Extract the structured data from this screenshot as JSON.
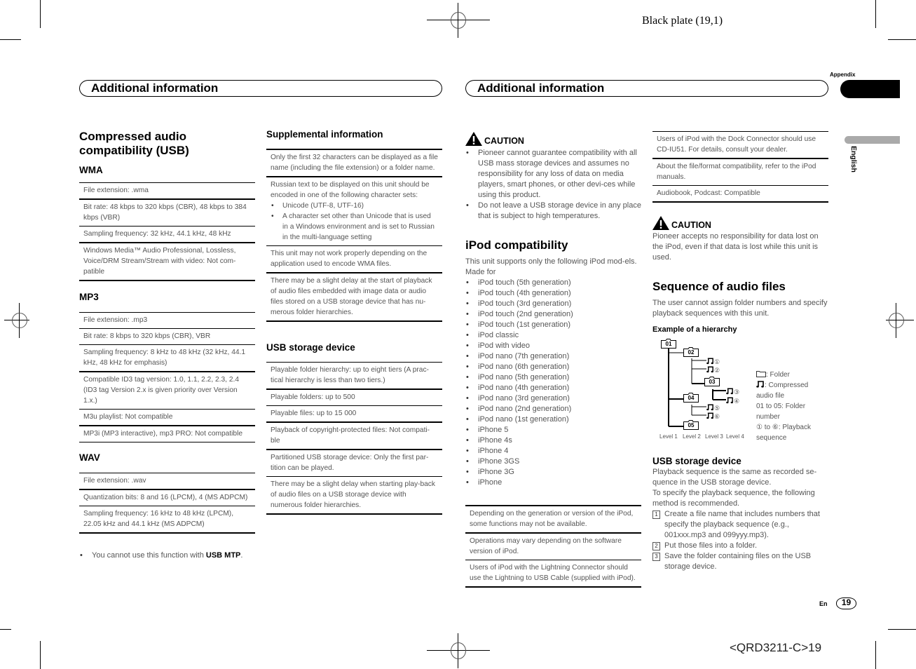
{
  "print_marks": {
    "plate": "Black plate (19,1)",
    "code": "<QRD3211-C>19"
  },
  "header": {
    "left_title": "Additional information",
    "right_title": "Additional information",
    "section_tab": "Appendix",
    "language_tab": "English"
  },
  "col1": {
    "title": "Compressed audio compatibility (USB)",
    "wma": {
      "heading": "WMA",
      "rows": [
        "File extension: .wma",
        "Bit rate: 48 kbps to 320 kbps (CBR), 48 kbps to 384 kbps (VBR)",
        "Sampling frequency: 32 kHz, 44.1 kHz, 48 kHz",
        "Windows Media™ Audio Professional, Lossless, Voice/DRM Stream/Stream with video: Not com-patible"
      ]
    },
    "mp3": {
      "heading": "MP3",
      "rows": [
        "File extension: .mp3",
        "Bit rate: 8 kbps to 320 kbps (CBR), VBR",
        "Sampling frequency: 8 kHz to 48 kHz (32 kHz, 44.1 kHz, 48 kHz for emphasis)",
        "Compatible ID3 tag version: 1.0, 1.1, 2.2, 2.3, 2.4 (ID3 tag Version 2.x is given priority over Version 1.x.)",
        "M3u playlist: Not compatible",
        "MP3i (MP3 interactive), mp3 PRO: Not compatible"
      ]
    },
    "wav": {
      "heading": "WAV",
      "rows": [
        "File extension: .wav",
        "Quantization bits: 8 and 16 (LPCM), 4 (MS ADPCM)",
        "Sampling frequency: 16 kHz to 48 kHz (LPCM), 22.05 kHz and 44.1 kHz (MS ADPCM)"
      ]
    },
    "note_prefix": "You cannot use this function with ",
    "note_bold": "USB MTP",
    "note_suffix": "."
  },
  "col2": {
    "supplemental": {
      "heading": "Supplemental information",
      "row1": "Only the first 32 characters can be displayed as a file name (including the file extension) or a folder name.",
      "row2_intro": "Russian text to be displayed on this unit should be encoded in one of the following character sets:",
      "row2_items": [
        "Unicode (UTF-8, UTF-16)",
        "A character set other than Unicode that is used in a Windows environment and is set to Russian in the multi-language setting"
      ],
      "row3": "This unit may not work properly depending on the application used to encode WMA files.",
      "row4": "There may be a slight delay at the start of playback of audio files embedded with image data or audio files stored on a USB storage device that has nu-merous folder hierarchies."
    },
    "usb": {
      "heading": "USB storage device",
      "rows": [
        "Playable folder hierarchy: up to eight tiers (A prac-tical hierarchy is less than two tiers.)",
        "Playable folders: up to 500",
        "Playable files: up to 15 000",
        "Playback of copyright-protected files: Not compati-ble",
        "Partitioned USB storage device: Only the first par-tition can be played.",
        "There may be a slight delay when starting play-back of audio files on a USB storage device with numerous folder hierarchies."
      ]
    }
  },
  "col3": {
    "caution_label": "CAUTION",
    "caution_items": [
      "Pioneer cannot guarantee compatibility with all USB mass storage devices and assumes no responsibility for any loss of data on media players, smart phones, or other devi-ces while using this product.",
      "Do not leave a USB storage device in any place that is subject to high temperatures."
    ],
    "ipod": {
      "heading": "iPod compatibility",
      "intro": "This unit supports only the following iPod mod-els.",
      "made_for": "Made for",
      "models": [
        "iPod touch (5th generation)",
        "iPod touch (4th generation)",
        "iPod touch (3rd generation)",
        "iPod touch (2nd generation)",
        "iPod touch (1st generation)",
        "iPod classic",
        "iPod with video",
        "iPod nano (7th generation)",
        "iPod nano (6th generation)",
        "iPod nano (5th generation)",
        "iPod nano (4th generation)",
        "iPod nano (3rd generation)",
        "iPod nano (2nd generation)",
        "iPod nano (1st generation)",
        "iPhone 5",
        "iPhone 4s",
        "iPhone 4",
        "iPhone 3GS",
        "iPhone 3G",
        "iPhone"
      ],
      "notes": [
        "Depending on the generation or version of the iPod, some functions may not be available.",
        "Operations may vary depending on the software version of iPod.",
        "Users of iPod with the Lightning Connector should use the Lightning to USB Cable (supplied with iPod)."
      ]
    }
  },
  "col4": {
    "notes": [
      "Users of iPod with the Dock Connector should use CD-IU51. For details, consult your dealer.",
      "About the file/format compatibility, refer to the iPod manuals.",
      "Audiobook, Podcast: Compatible"
    ],
    "caution_label": "CAUTION",
    "caution_text": "Pioneer accepts no responsibility for data lost on the iPod, even if that data is lost while this unit is used.",
    "sequence": {
      "heading": "Sequence of audio files",
      "text": "The user cannot assign folder numbers and specify playback sequences with this unit.",
      "example_heading": "Example of a hierarchy",
      "folders": [
        "01",
        "02",
        "03",
        "04",
        "05"
      ],
      "files": [
        "①",
        "②",
        "③",
        "④",
        "⑤",
        "⑥"
      ],
      "levels": [
        "Level 1",
        "Level 2",
        "Level 3",
        "Level 4"
      ],
      "legend": {
        "folder": ": Folder",
        "file": ": Compressed audio file",
        "numbers": "01 to 05: Folder number",
        "sequence": "① to ⑥: Playback sequence"
      }
    },
    "usb": {
      "heading": "USB storage device",
      "text1": "Playback sequence is the same as recorded se-quence in the USB storage device.",
      "text2": "To specify the playback sequence, the following method is recommended.",
      "steps": [
        {
          "num": "1",
          "text": "Create a file name that includes numbers that specify the playback sequence (e.g., 001xxx.mp3 and 099yyy.mp3)."
        },
        {
          "num": "2",
          "text": "Put those files into a folder."
        },
        {
          "num": "3",
          "text": "Save the folder containing files on the USB storage device."
        }
      ]
    }
  },
  "footer": {
    "lang": "En",
    "page": "19"
  }
}
